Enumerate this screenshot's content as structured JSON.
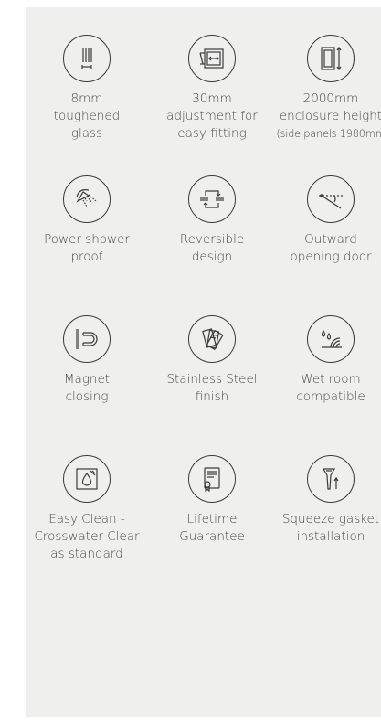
{
  "features": [
    {
      "icon": "glass-thickness-icon",
      "lines": [
        "8mm",
        "toughened",
        "glass"
      ]
    },
    {
      "icon": "adjustment-icon",
      "lines": [
        "30mm",
        "adjustment for",
        "easy fitting"
      ]
    },
    {
      "icon": "enclosure-height-icon",
      "lines": [
        "2000mm",
        "enclosure height",
        "(side panels 1980mm"
      ]
    },
    {
      "icon": "shower-head-icon",
      "lines": [
        "Power shower",
        "proof"
      ]
    },
    {
      "icon": "reversible-icon",
      "lines": [
        "Reversible",
        "design"
      ]
    },
    {
      "icon": "outward-door-icon",
      "lines": [
        "Outward",
        "opening door"
      ]
    },
    {
      "icon": "magnet-icon",
      "lines": [
        "Magnet",
        "closing"
      ]
    },
    {
      "icon": "steel-finish-icon",
      "lines": [
        "Stainless Steel",
        "finish"
      ]
    },
    {
      "icon": "wet-room-icon",
      "lines": [
        "Wet room",
        "compatible"
      ]
    },
    {
      "icon": "easy-clean-icon",
      "lines": [
        "Easy Clean -",
        "Crosswater Clear",
        "as standard"
      ]
    },
    {
      "icon": "guarantee-icon",
      "lines": [
        "Lifetime",
        "Guarantee"
      ]
    },
    {
      "icon": "squeeze-gasket-icon",
      "lines": [
        "Squeeze gasket",
        "installation"
      ]
    }
  ]
}
